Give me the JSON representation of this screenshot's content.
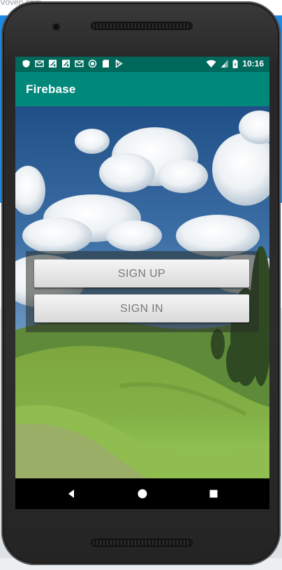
{
  "background_page": {
    "top_text": "Voven.com"
  },
  "status_bar": {
    "left_icons": [
      "shield-icon",
      "gmail-icon",
      "maps-icon",
      "maps-icon",
      "gmail-icon",
      "record-icon",
      "sd-card-icon",
      "play-store-icon"
    ],
    "right_icons": [
      "wifi-icon",
      "signal-icon",
      "battery-icon"
    ],
    "time": "10:16",
    "color": "#00695c"
  },
  "app_bar": {
    "title": "Firebase",
    "color": "#00897b"
  },
  "main": {
    "background_image": "sky-and-green-hills-landscape",
    "sign_up_label": "SIGN UP",
    "sign_in_label": "SIGN IN"
  },
  "nav_bar": {
    "back_icon": "back-icon",
    "home_icon": "home-icon",
    "recents_icon": "recents-icon"
  }
}
